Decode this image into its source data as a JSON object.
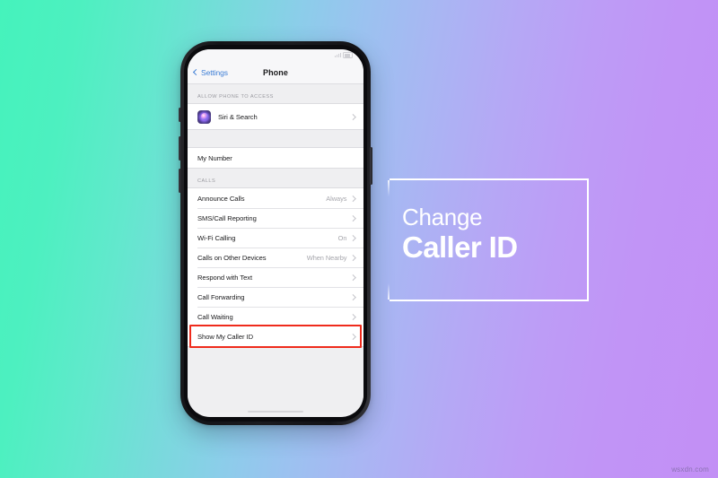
{
  "background": {
    "gradient_from": "#45f3bc",
    "gradient_to": "#c28ff5"
  },
  "phone": {
    "status_bar": {
      "carrier": "",
      "time": "",
      "battery": ""
    },
    "nav": {
      "back_label": "Settings",
      "title": "Phone",
      "back_icon": "chevron-left-icon",
      "accent_color": "#3f7fd6"
    },
    "sections": [
      {
        "header": "ALLOW PHONE TO ACCESS",
        "rows": [
          {
            "label": "Siri & Search",
            "value": "",
            "icon": "siri-icon",
            "chevron": true,
            "highlighted": false
          }
        ]
      },
      {
        "header": "",
        "rows": [
          {
            "label": "My Number",
            "value": "",
            "icon": "",
            "chevron": false,
            "highlighted": false
          }
        ]
      },
      {
        "header": "CALLS",
        "rows": [
          {
            "label": "Announce Calls",
            "value": "Always",
            "icon": "",
            "chevron": true,
            "highlighted": false
          },
          {
            "label": "SMS/Call Reporting",
            "value": "",
            "icon": "",
            "chevron": true,
            "highlighted": false
          },
          {
            "label": "Wi-Fi Calling",
            "value": "On",
            "icon": "",
            "chevron": true,
            "highlighted": false
          },
          {
            "label": "Calls on Other Devices",
            "value": "When Nearby",
            "icon": "",
            "chevron": true,
            "highlighted": false
          },
          {
            "label": "Respond with Text",
            "value": "",
            "icon": "",
            "chevron": true,
            "highlighted": false
          },
          {
            "label": "Call Forwarding",
            "value": "",
            "icon": "",
            "chevron": true,
            "highlighted": false
          },
          {
            "label": "Call Waiting",
            "value": "",
            "icon": "",
            "chevron": true,
            "highlighted": false
          },
          {
            "label": "Show My Caller ID",
            "value": "",
            "icon": "",
            "chevron": true,
            "highlighted": true
          }
        ]
      }
    ],
    "highlight_color": "#ef2b1c"
  },
  "callout": {
    "line1": "Change",
    "line2": "Caller ID",
    "frame_color": "#ffffff"
  },
  "watermark": {
    "text": "wsxdn.com"
  }
}
